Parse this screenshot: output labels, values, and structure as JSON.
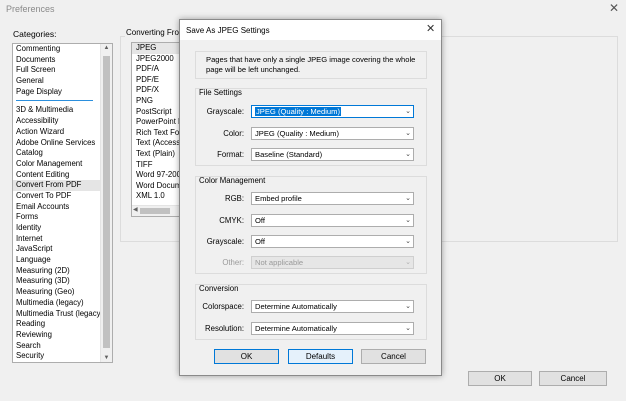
{
  "window": {
    "title": "Preferences",
    "close": "✕"
  },
  "categories": {
    "label": "Categories:",
    "top_items": [
      "Commenting",
      "Documents",
      "Full Screen",
      "General",
      "Page Display"
    ],
    "items": [
      "3D & Multimedia",
      "Accessibility",
      "Action Wizard",
      "Adobe Online Services",
      "Catalog",
      "Color Management",
      "Content Editing",
      "Convert From PDF",
      "Convert To PDF",
      "Email Accounts",
      "Forms",
      "Identity",
      "Internet",
      "JavaScript",
      "Language",
      "Measuring (2D)",
      "Measuring (3D)",
      "Measuring (Geo)",
      "Multimedia (legacy)",
      "Multimedia Trust (legacy)",
      "Reading",
      "Reviewing",
      "Search",
      "Security"
    ],
    "selected": "Convert From PDF"
  },
  "converting": {
    "label": "Converting From PDF",
    "formats": [
      "JPEG",
      "JPEG2000",
      "PDF/A",
      "PDF/E",
      "PDF/X",
      "PNG",
      "PostScript",
      "PowerPoint P",
      "Rich Text Form",
      "Text (Accessib",
      "Text (Plain)",
      "TIFF",
      "Word 97-2003",
      "Word Docum",
      "XML 1.0"
    ],
    "selected": "JPEG"
  },
  "buttons": {
    "ok": "OK",
    "cancel": "Cancel"
  },
  "dialog": {
    "title": "Save As JPEG Settings",
    "close": "✕",
    "info": "Pages that have only a single JPEG image covering the whole page will be left unchanged.",
    "file_settings": {
      "title": "File Settings",
      "grayscale_label": "Grayscale:",
      "grayscale_value": "JPEG (Quality : Medium)",
      "color_label": "Color:",
      "color_value": "JPEG (Quality : Medium)",
      "format_label": "Format:",
      "format_value": "Baseline (Standard)"
    },
    "color_management": {
      "title": "Color Management",
      "rgb_label": "RGB:",
      "rgb_value": "Embed profile",
      "cmyk_label": "CMYK:",
      "cmyk_value": "Off",
      "grayscale_label": "Grayscale:",
      "grayscale_value": "Off",
      "other_label": "Other:",
      "other_value": "Not applicable"
    },
    "conversion": {
      "title": "Conversion",
      "colorspace_label": "Colorspace:",
      "colorspace_value": "Determine Automatically",
      "resolution_label": "Resolution:",
      "resolution_value": "Determine Automatically"
    },
    "buttons": {
      "ok": "OK",
      "defaults": "Defaults",
      "cancel": "Cancel"
    }
  }
}
